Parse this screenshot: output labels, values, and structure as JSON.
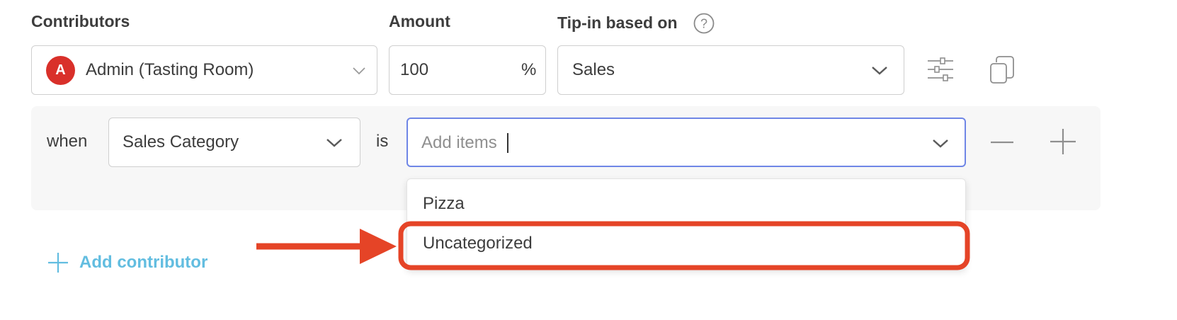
{
  "headers": {
    "contributors": "Contributors",
    "amount": "Amount",
    "tip_in_based_on": "Tip-in based on"
  },
  "contributor": {
    "avatar_letter": "A",
    "name": "Admin (Tasting Room)"
  },
  "amount": {
    "value": "100",
    "unit": "%"
  },
  "tip_basis": {
    "value": "Sales"
  },
  "condition": {
    "when_label": "when",
    "field_value": "Sales Category",
    "operator_label": "is",
    "items_placeholder": "Add items"
  },
  "dropdown": {
    "options": [
      "Pizza",
      "Uncategorized"
    ]
  },
  "add_contributor_label": "Add contributor",
  "colors": {
    "avatar": "#d9302a",
    "link": "#62bde0",
    "focus_border": "#6f86e6",
    "annotation": "#e54427"
  }
}
